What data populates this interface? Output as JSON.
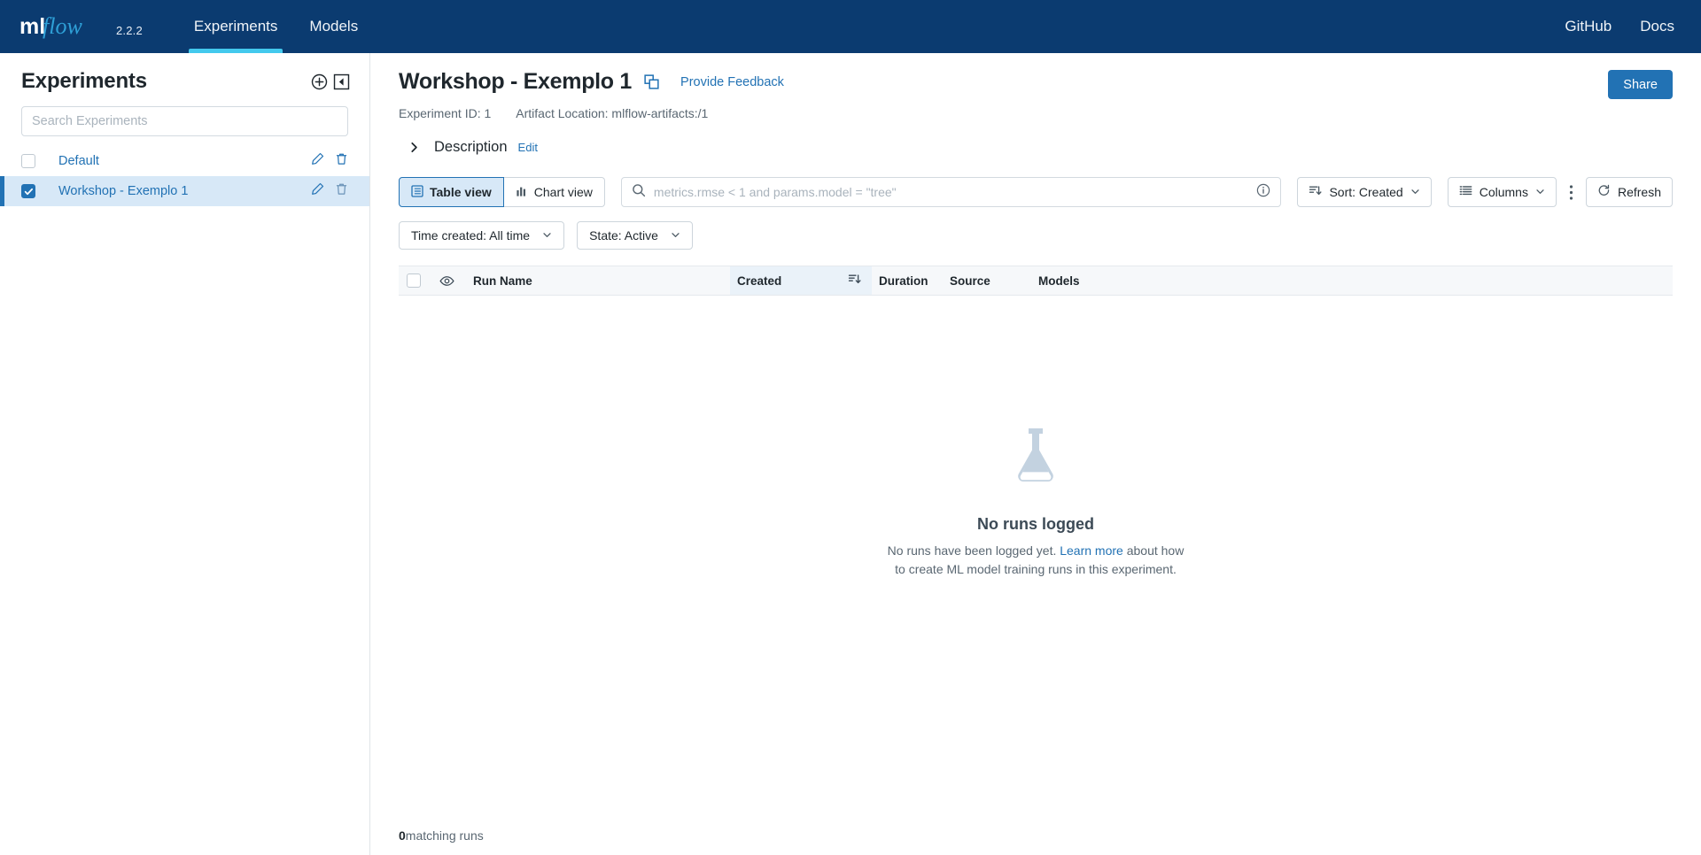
{
  "navbar": {
    "brand_text": "mlflow",
    "version": "2.2.2",
    "links": [
      {
        "label": "Experiments",
        "active": true
      },
      {
        "label": "Models",
        "active": false
      }
    ],
    "right_links": [
      {
        "label": "GitHub"
      },
      {
        "label": "Docs"
      }
    ],
    "background": "#0b3b70",
    "active_underline": "#43c9ed"
  },
  "sidebar": {
    "title": "Experiments",
    "create_icon": "plus-circle-icon",
    "collapse_icon": "collapse-left-icon",
    "search": {
      "placeholder": "Search Experiments",
      "value": ""
    },
    "items": [
      {
        "label": "Default",
        "selected": false,
        "checked": false
      },
      {
        "label": "Workshop - Exemplo 1",
        "selected": true,
        "checked": true
      }
    ],
    "row_actions": [
      {
        "icon": "pencil-icon",
        "name": "rename-experiment"
      },
      {
        "icon": "trash-icon",
        "name": "delete-experiment"
      }
    ]
  },
  "header": {
    "experiment_title": "Workshop - Exemplo 1",
    "copy_icon": "copy-icon",
    "feedback_link": "Provide Feedback",
    "share_button": "Share",
    "meta": [
      "Experiment ID: 1",
      "Artifact Location: mlflow-artifacts:/1"
    ],
    "description": {
      "label": "Description",
      "edit_label": "Edit",
      "chevron": "chevron-right-icon",
      "expanded": false
    }
  },
  "toolbar": {
    "views": [
      {
        "label": "Table view",
        "icon": "table-icon",
        "active": true
      },
      {
        "label": "Chart view",
        "icon": "chart-icon",
        "active": false
      }
    ],
    "search": {
      "placeholder": "metrics.rmse < 1 and params.model = \"tree\"",
      "value": "",
      "icon": "search-icon",
      "info_icon": "info-circle-icon"
    },
    "sort_label": "Sort: Created",
    "columns_label": "Columns",
    "kebab_icon": "kebab-menu-icon",
    "refresh_label": "Refresh",
    "refresh_icon": "refresh-icon"
  },
  "filters": [
    {
      "label": "Time created: All time",
      "name": "time-created-filter"
    },
    {
      "label": "State: Active",
      "name": "state-filter"
    }
  ],
  "table": {
    "columns": [
      {
        "label": "",
        "name": "select-all-checkbox"
      },
      {
        "label": "",
        "name": "visibility-eye-icon"
      },
      {
        "label": "Run Name",
        "name": "column-run-name"
      },
      {
        "label": "Created",
        "name": "column-created",
        "sorted": true
      },
      {
        "label": "Duration",
        "name": "column-duration"
      },
      {
        "label": "Source",
        "name": "column-source"
      },
      {
        "label": "Models",
        "name": "column-models"
      }
    ],
    "rows": []
  },
  "empty_state": {
    "icon": "flask-icon",
    "title": "No runs logged",
    "text_before": "No runs have been logged yet. ",
    "link": "Learn more",
    "text_after": " about how to create ML model training runs in this experiment."
  },
  "footer": {
    "count": "0",
    "label": " matching runs"
  },
  "colors": {
    "accent": "#2272b4",
    "navbar": "#0b3b70",
    "selected_row": "#d7e8f7",
    "muted_text": "#5a6772"
  }
}
